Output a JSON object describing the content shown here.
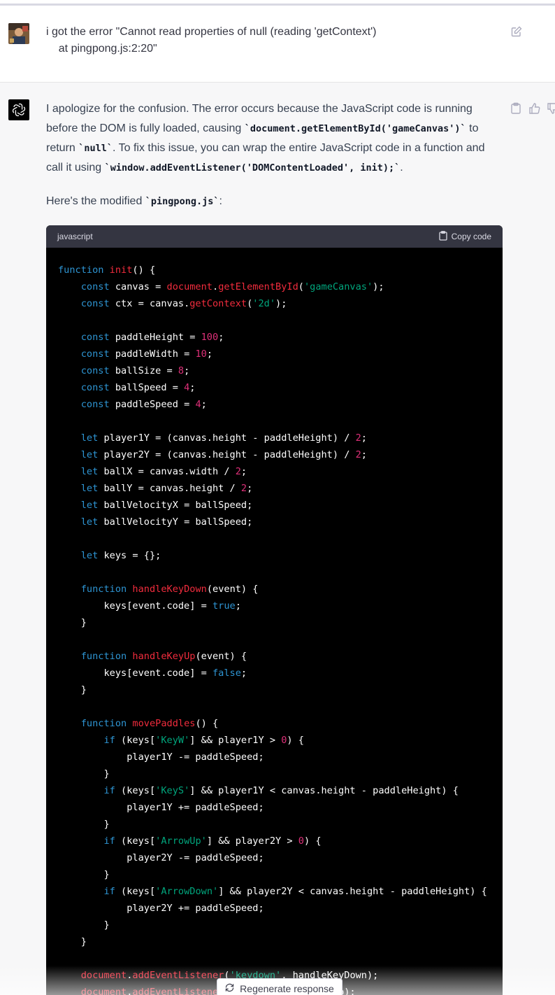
{
  "user_message": {
    "text": "i got the error \"Cannot read properties of null (reading 'getContext')\n    at pingpong.js:2:20\""
  },
  "assistant_message": {
    "p1_a": "I apologize for the confusion. The error occurs because the JavaScript code is running before the DOM is fully loaded, causing ",
    "p1_code1": "`document.getElementById('gameCanvas')`",
    "p1_b": " to return ",
    "p1_code2": "`null`",
    "p1_c": ". To fix this issue, you can wrap the entire JavaScript code in a function and call it using ",
    "p1_code3": "`window.addEventListener('DOMContentLoaded', init);`",
    "p1_d": ".",
    "p2_a": "Here's the modified ",
    "p2_code": "`pingpong.js`",
    "p2_b": ":"
  },
  "code_block": {
    "language": "javascript",
    "copy_label": "Copy code"
  },
  "footer": {
    "regenerate_label": "Regenerate response"
  },
  "icons": {
    "edit": "edit-icon",
    "copy": "clipboard-icon",
    "thumbs_up": "thumbs-up-icon",
    "thumbs_down": "thumbs-down-icon",
    "regenerate": "refresh-icon",
    "assistant": "openai-logo-icon"
  },
  "colors": {
    "code_background": "#000000",
    "code_header": "#343541",
    "assistant_background": "#f7f7f8",
    "keyword": "#2e95d3",
    "function_name": "#f22c3d",
    "string": "#00a67d",
    "number": "#df3079"
  }
}
